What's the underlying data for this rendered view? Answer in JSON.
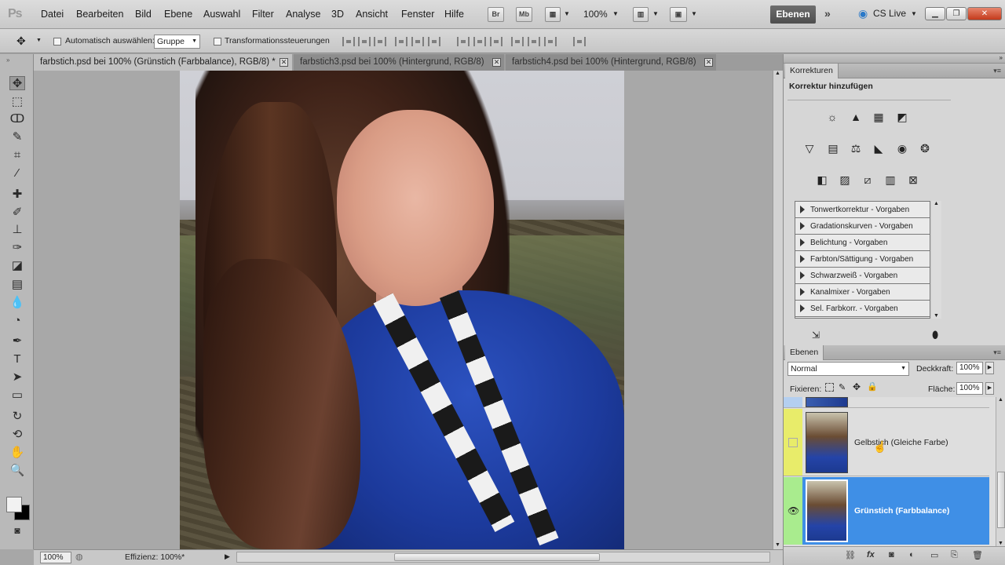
{
  "app": {
    "logo": "Ps"
  },
  "menu": [
    "Datei",
    "Bearbeiten",
    "Bild",
    "Ebene",
    "Auswahl",
    "Filter",
    "Analyse",
    "3D",
    "Ansicht",
    "Fenster",
    "Hilfe"
  ],
  "appbar": {
    "bridge": "Br",
    "minibridge": "Mb",
    "zoom": "100%",
    "workspace": "Ebenen",
    "cslive": "CS Live"
  },
  "options": {
    "auto_select_label": "Automatisch auswählen:",
    "auto_select_value": "Gruppe",
    "transform_label": "Transformationssteuerungen"
  },
  "tabs": [
    {
      "label": "farbstich.psd bei 100% (Grünstich (Farbbalance), RGB/8) *",
      "active": true
    },
    {
      "label": "farbstich3.psd bei 100% (Hintergrund, RGB/8)",
      "active": false
    },
    {
      "label": "farbstich4.psd bei 100% (Hintergrund, RGB/8)",
      "active": false
    }
  ],
  "status": {
    "zoom": "100%",
    "info": "Effizienz: 100%*"
  },
  "adjustments": {
    "panel_title": "Korrekturen",
    "heading": "Korrektur hinzufügen",
    "presets": [
      "Tonwertkorrektur - Vorgaben",
      "Gradationskurven - Vorgaben",
      "Belichtung - Vorgaben",
      "Farbton/Sättigung - Vorgaben",
      "Schwarzweiß - Vorgaben",
      "Kanalmixer - Vorgaben",
      "Sel. Farbkorr. - Vorgaben"
    ]
  },
  "layers": {
    "panel_title": "Ebenen",
    "blend_mode": "Normal",
    "opacity_label": "Deckkraft:",
    "opacity": "100%",
    "lock_label": "Fixieren:",
    "fill_label": "Fläche:",
    "fill": "100%",
    "items": [
      {
        "name": "Gelbstich (Gleiche Farbe)",
        "selected": false,
        "color": "#e8ec6a"
      },
      {
        "name": "Grünstich (Farbbalance)",
        "selected": true,
        "color": "#a9ec8e"
      }
    ]
  },
  "colors": {
    "selection": "#3f8fe6",
    "layer_yellow": "#e8ec6a",
    "layer_green": "#a9ec8e",
    "layer_blue": "#b4cff0"
  }
}
